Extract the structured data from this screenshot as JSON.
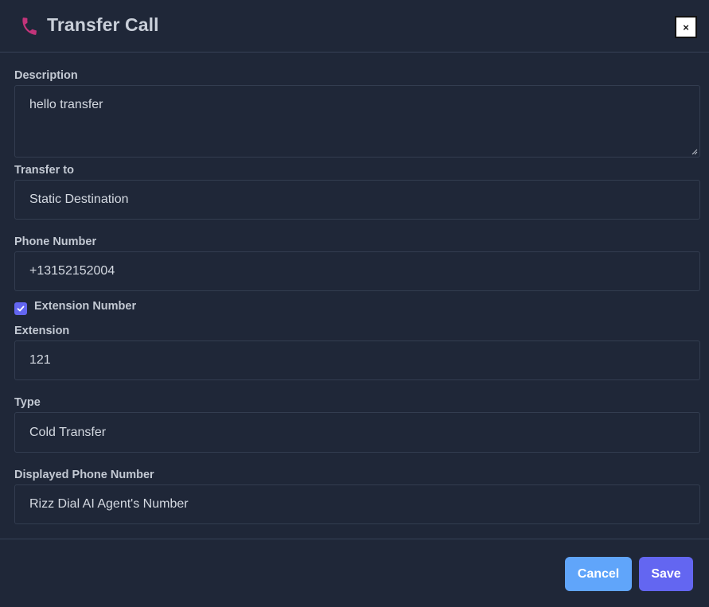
{
  "dialog": {
    "title": "Transfer Call",
    "close_label": "×"
  },
  "fields": {
    "description": {
      "label": "Description",
      "value": "hello transfer"
    },
    "transfer_to": {
      "label": "Transfer to",
      "value": "Static Destination"
    },
    "phone_number": {
      "label": "Phone Number",
      "value": "+13152152004"
    },
    "extension_checkbox": {
      "label": "Extension Number",
      "checked": true
    },
    "extension": {
      "label": "Extension",
      "value": "121"
    },
    "type": {
      "label": "Type",
      "value": "Cold Transfer"
    },
    "displayed_phone_number": {
      "label": "Displayed Phone Number",
      "value": "Rizz Dial AI Agent's Number"
    }
  },
  "footer": {
    "cancel_label": "Cancel",
    "save_label": "Save"
  },
  "colors": {
    "background": "#1f2738",
    "phone_icon": "#d63384",
    "checkbox": "#6366f1",
    "cancel_button": "#60a5fa",
    "save_button": "#6366f1"
  },
  "icons": {
    "header": "phone-icon",
    "close": "close-icon",
    "checkbox": "checkmark-icon"
  }
}
